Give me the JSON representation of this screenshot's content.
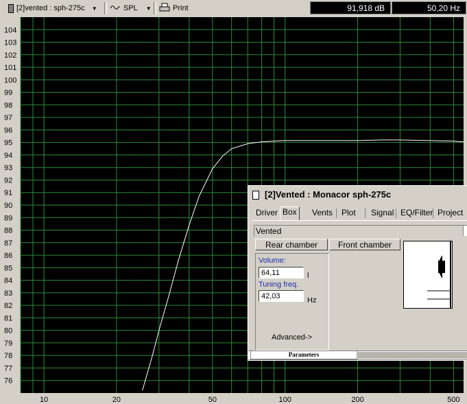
{
  "toolbar": {
    "project_label": "[2]vented : sph-275c",
    "mode_label": "SPL",
    "print_label": "Print",
    "readout_db": "91,918 dB",
    "readout_hz": "50,20 Hz",
    "icons": [
      "speaker-icon",
      "dropdown-arrow-icon",
      "waveform-icon",
      "printer-icon"
    ]
  },
  "chart_data": {
    "type": "line",
    "title": "",
    "xlabel": "",
    "ylabel": "",
    "xscale": "log",
    "xlim": [
      8,
      550
    ],
    "ylim": [
      75,
      105
    ],
    "x_ticks": [
      10,
      20,
      50,
      100,
      200,
      500
    ],
    "y_ticks": [
      76,
      77,
      78,
      79,
      80,
      81,
      82,
      83,
      84,
      85,
      86,
      87,
      88,
      89,
      90,
      91,
      92,
      93,
      94,
      95,
      96,
      97,
      98,
      99,
      100,
      101,
      102,
      103,
      104
    ],
    "grid": true,
    "background": "#000000",
    "grid_color": "#2e8b3a",
    "line_color": "#ffffff",
    "series": [
      {
        "x": [
          25.6,
          28,
          30,
          33,
          36,
          40,
          44,
          50,
          55,
          60,
          70,
          80,
          90,
          100,
          120,
          150,
          200,
          250,
          300,
          400,
          500,
          550
        ],
        "y": [
          75.2,
          77.8,
          80.0,
          82.8,
          85.5,
          88.4,
          90.7,
          92.9,
          93.9,
          94.5,
          94.9,
          95.05,
          95.1,
          95.15,
          95.15,
          95.15,
          95.15,
          95.2,
          95.2,
          95.15,
          95.1,
          95.05
        ]
      }
    ]
  },
  "dialog": {
    "title": "[2]Vented : Monacor sph-275c",
    "tabs": [
      "Driver",
      "Box",
      "Vents",
      "Plot",
      "Signal",
      "EQ/Filter",
      "Project"
    ],
    "active_tab": "Box",
    "box_type": "Vented",
    "rear_button": "Rear chamber",
    "front_button": "Front chamber",
    "volume_label": "Volume:",
    "volume_value": "64,11",
    "volume_unit": "l",
    "tuning_label": "Tuning freq.",
    "tuning_value": "42,03",
    "tuning_unit": "Hz",
    "advanced": "Advanced->",
    "status_tab": "Parameters",
    "label_color": "#1a2fa8"
  }
}
